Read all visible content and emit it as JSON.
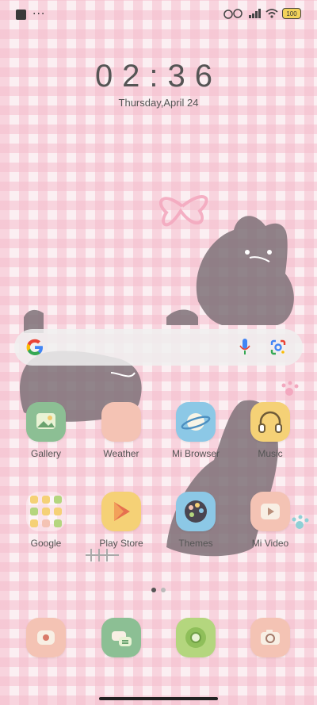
{
  "status": {
    "battery": "100"
  },
  "clock": {
    "time": "02:36",
    "date": "Thursday,April 24"
  },
  "apps_row1": [
    {
      "label": "Gallery",
      "icon": "gallery-icon",
      "color": "#8cbf94"
    },
    {
      "label": "Weather",
      "icon": "weather-icon",
      "color": "#f4c3b4"
    },
    {
      "label": "Mi Browser",
      "icon": "browser-planet-icon",
      "color": "#8cc8e6"
    },
    {
      "label": "Music",
      "icon": "headphones-icon",
      "color": "#f5d176"
    }
  ],
  "apps_row2": [
    {
      "label": "Google",
      "icon": "google-folder-icon",
      "color": "#fbeff2"
    },
    {
      "label": "Play Store",
      "icon": "play-store-icon",
      "color": "#f5d176"
    },
    {
      "label": "Themes",
      "icon": "palette-icon",
      "color": "#8cc8e6"
    },
    {
      "label": "Mi Video",
      "icon": "video-icon",
      "color": "#f4c3b4"
    }
  ],
  "dock": [
    {
      "icon": "phone-icon",
      "color": "#f4c3b4"
    },
    {
      "icon": "messages-icon",
      "color": "#8cbf94"
    },
    {
      "icon": "chrome-icon",
      "color": "#b4d67e"
    },
    {
      "icon": "camera-icon",
      "color": "#f4c3b4"
    }
  ]
}
